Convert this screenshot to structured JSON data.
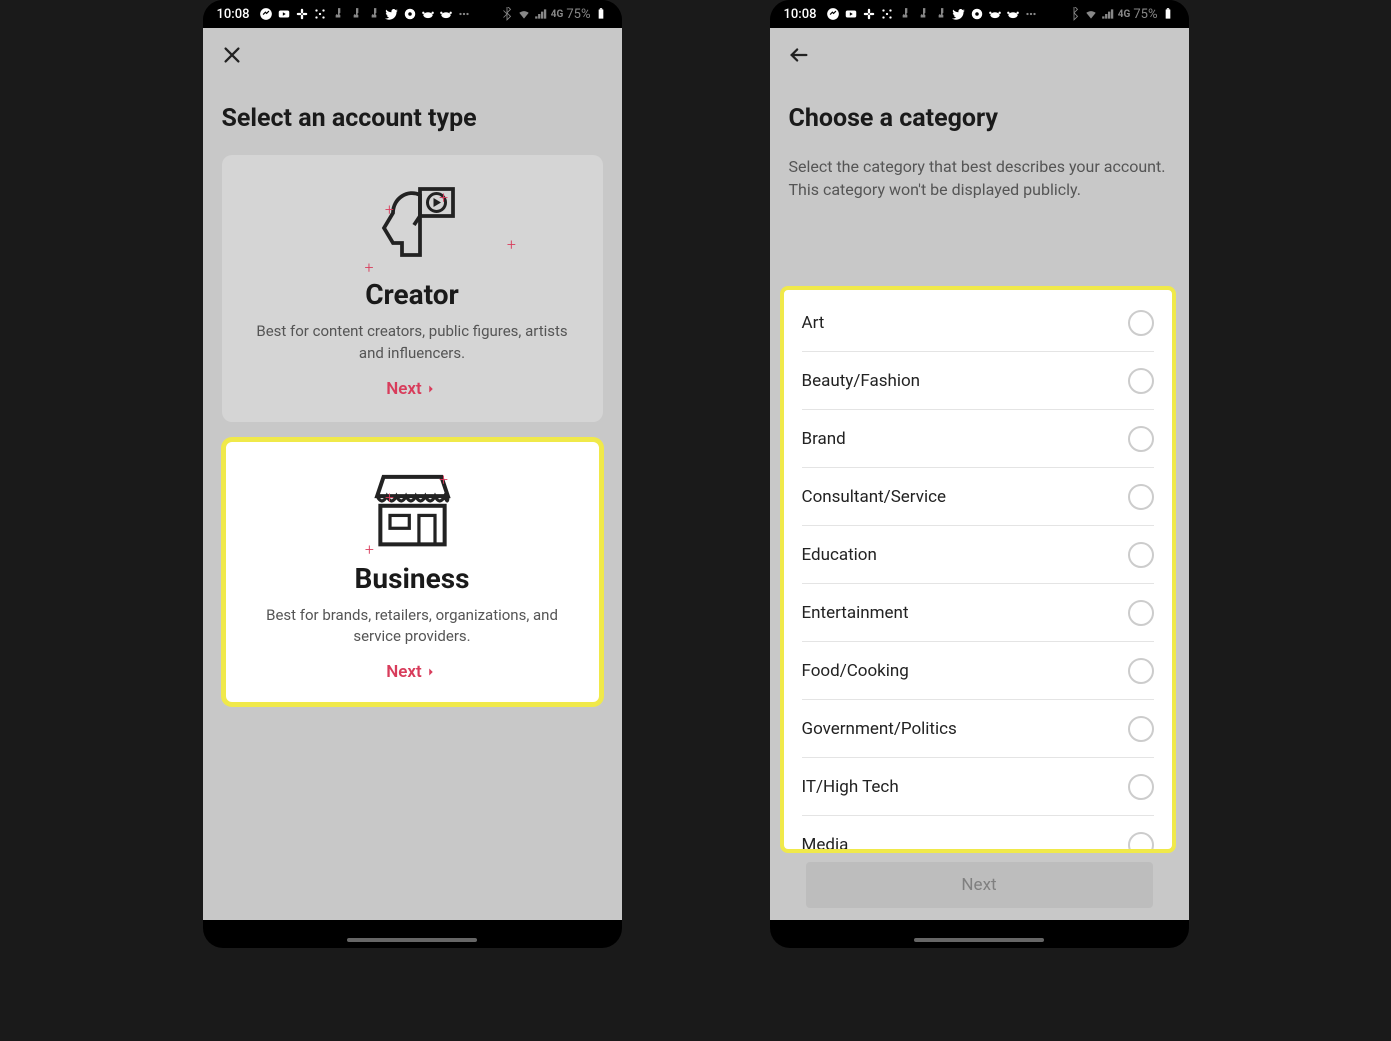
{
  "status": {
    "time": "10:08",
    "battery": "75%"
  },
  "left": {
    "heading": "Select an account type",
    "creator": {
      "title": "Creator",
      "desc": "Best for content creators, public figures, artists and influencers.",
      "next": "Next"
    },
    "business": {
      "title": "Business",
      "desc": "Best for brands, retailers, organizations, and service providers.",
      "next": "Next"
    }
  },
  "right": {
    "heading": "Choose a category",
    "sub": "Select the category that best describes your account. This category won't be displayed publicly.",
    "categories": {
      "0": "Art",
      "1": "Beauty/Fashion",
      "2": "Brand",
      "3": "Consultant/Service",
      "4": "Education",
      "5": "Entertainment",
      "6": "Food/Cooking",
      "7": "Government/Politics",
      "8": "IT/High Tech",
      "9": "Media"
    },
    "next_button": "Next"
  }
}
